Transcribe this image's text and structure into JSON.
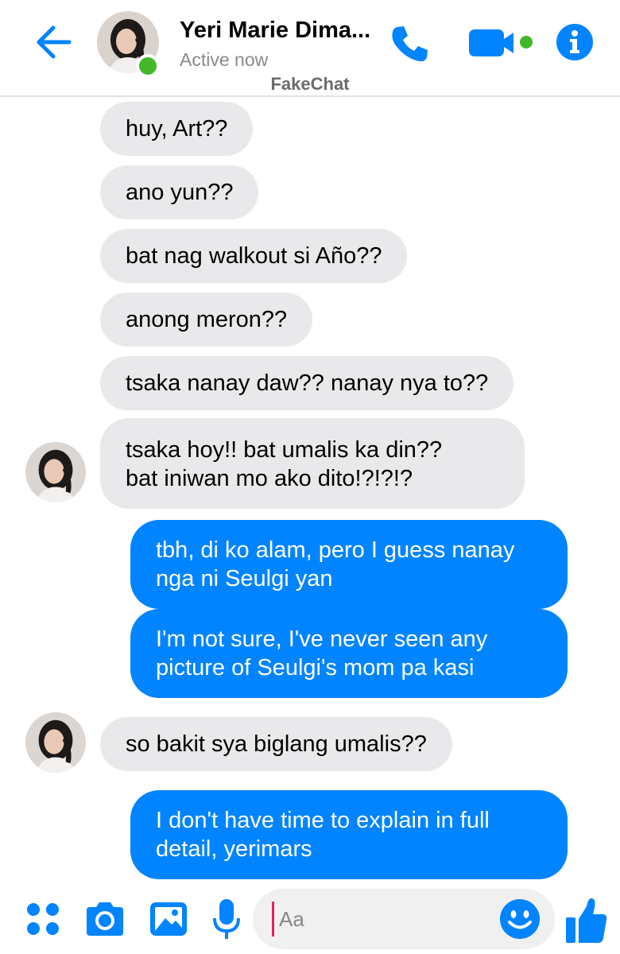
{
  "header": {
    "contact_name": "Yeri Marie Dima...",
    "status": "Active now",
    "app_label": "FakeChat"
  },
  "messages": [
    {
      "from": "them",
      "text": "huy, Art??"
    },
    {
      "from": "them",
      "text": "ano yun??"
    },
    {
      "from": "them",
      "text": "bat nag walkout si Año??"
    },
    {
      "from": "them",
      "text": "anong meron??"
    },
    {
      "from": "them",
      "text": "tsaka nanay daw?? nanay nya to??"
    },
    {
      "from": "them",
      "text": "tsaka hoy!! bat umalis ka din??\nbat iniwan mo ako dito!?!?!?"
    },
    {
      "from": "me",
      "text": "tbh, di ko alam, pero I guess nanay nga ni Seulgi yan"
    },
    {
      "from": "me",
      "text": "I'm not sure, I've never seen any picture of Seulgi's mom pa kasi"
    },
    {
      "from": "them",
      "text": "so bakit sya biglang umalis??"
    },
    {
      "from": "me",
      "text": "I don't have time to explain in full detail, yerimars"
    }
  ],
  "composer": {
    "placeholder": "Aa"
  },
  "icons": {
    "back": "back-arrow-icon",
    "call": "phone-icon",
    "video": "video-camera-icon",
    "info": "info-icon",
    "apps": "apps-grid-icon",
    "camera": "camera-icon",
    "gallery": "image-icon",
    "mic": "microphone-icon",
    "emoji": "emoji-icon",
    "like": "thumbs-up-icon"
  },
  "colors": {
    "accent": "#0084ff",
    "incoming_bubble": "#e9e9eb",
    "presence": "#42b72a"
  }
}
